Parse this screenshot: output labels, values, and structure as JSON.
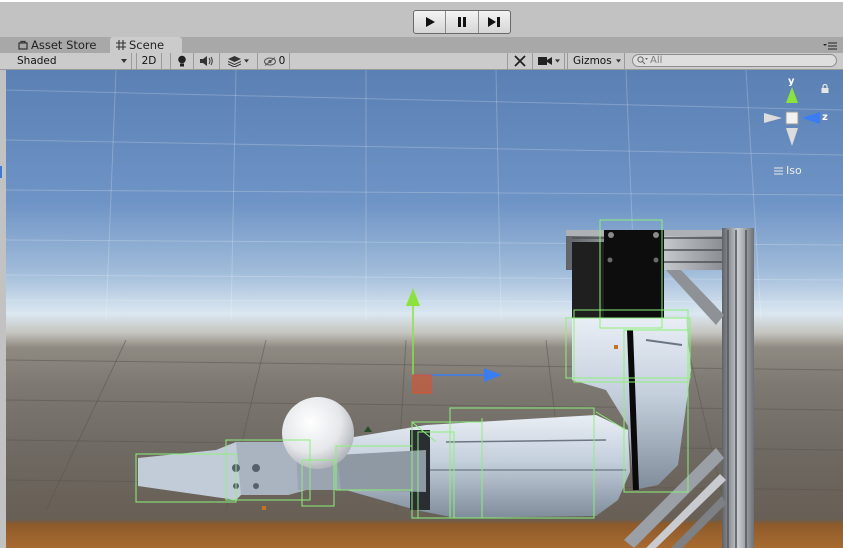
{
  "playbar": {
    "play_icon": "play-icon",
    "pause_icon": "pause-icon",
    "step_icon": "step-icon"
  },
  "tabs": [
    {
      "label": "Asset Store",
      "icon": "shop-icon"
    },
    {
      "label": "Scene",
      "icon": "grid-icon"
    }
  ],
  "toolbar": {
    "shading_mode": "Shaded",
    "mode_2d": "2D",
    "hidden_count": "0",
    "gizmos_label": "Gizmos",
    "search_placeholder": "All"
  },
  "gizmo": {
    "y_label": "y",
    "z_label": "z",
    "projection_label": "Iso"
  },
  "colors": {
    "x_axis": "#e0502a",
    "y_axis": "#8be33a",
    "z_axis": "#3a7df0",
    "selection": "#8cf07a"
  }
}
